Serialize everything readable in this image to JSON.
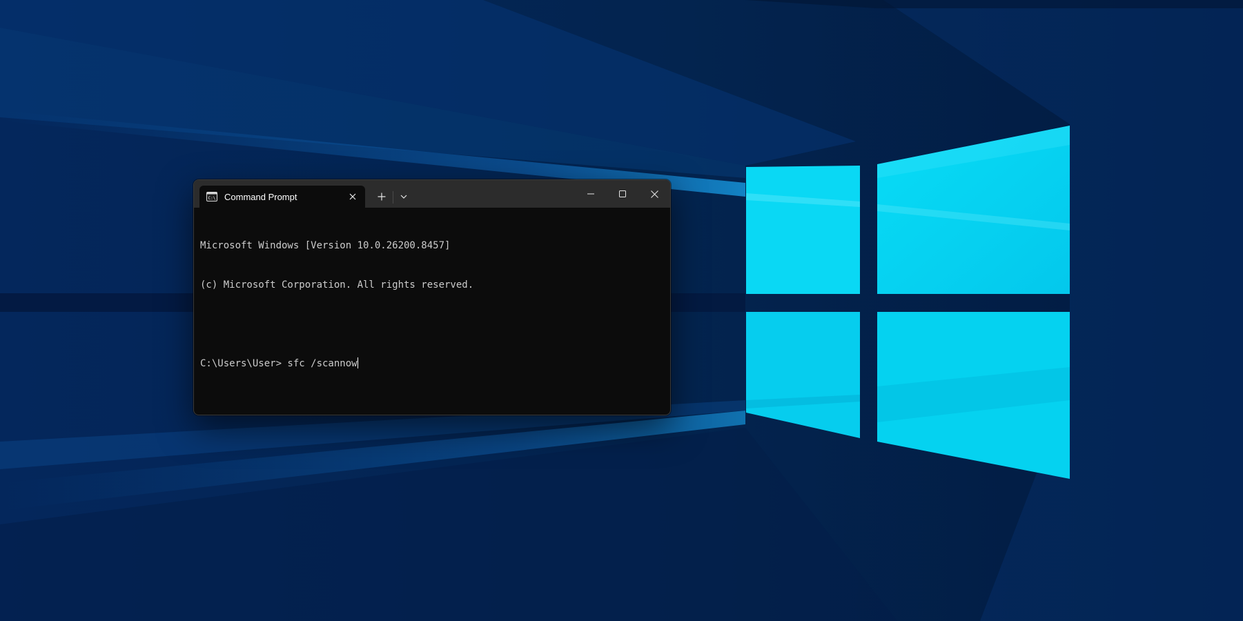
{
  "desktop": {
    "wallpaper_icon": "windows-logo-wallpaper",
    "colors": {
      "background": "#021a45",
      "logo_pane": "#00d4f0"
    }
  },
  "window": {
    "app_icon": "command-prompt-icon",
    "tab_title": "Command Prompt",
    "tab_close_icon": "close-icon",
    "new_tab_icon": "plus-icon",
    "dropdown_icon": "chevron-down-icon",
    "minimize_icon": "minimize-icon",
    "maximize_icon": "maximize-icon",
    "close_icon": "close-icon",
    "colors": {
      "titlebar": "#2c2c2c",
      "console_background": "#0c0c0c",
      "console_text": "#cccccc"
    }
  },
  "console": {
    "lines": [
      "Microsoft Windows [Version 10.0.26200.8457]",
      "(c) Microsoft Corporation. All rights reserved.",
      "",
      "C:\\Users\\User> sfc /scannow"
    ]
  }
}
